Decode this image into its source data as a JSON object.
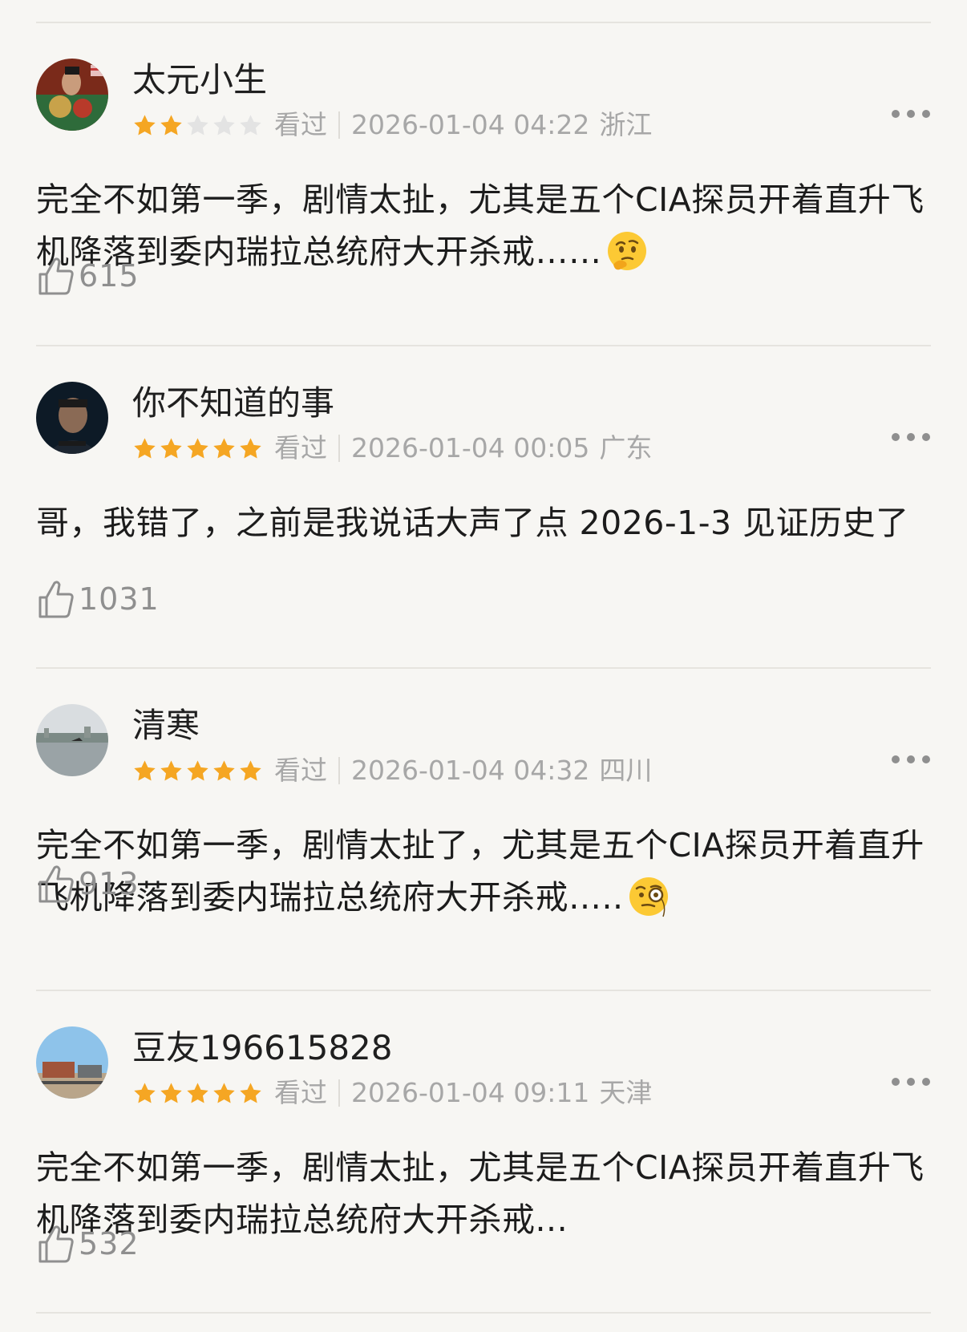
{
  "reviews": [
    {
      "username": "太元小生",
      "rating": 2,
      "max_rating": 5,
      "status": "看过",
      "datetime": "2026-01-04 04:22",
      "location": "浙江",
      "content": "完全不如第一季，剧情太扯，尤其是五个CIA探员开着直升飞机降落到委内瑞拉总统府大开杀戒……",
      "emoji": "thinking-face",
      "likes": "615"
    },
    {
      "username": "你不知道的事",
      "rating": 5,
      "max_rating": 5,
      "status": "看过",
      "datetime": "2026-01-04 00:05",
      "location": "广东",
      "content": "哥，我错了，之前是我说话大声了点 2026-1-3 见证历史了",
      "emoji": "",
      "likes": "1031"
    },
    {
      "username": "清寒",
      "rating": 5,
      "max_rating": 5,
      "status": "看过",
      "datetime": "2026-01-04 04:32",
      "location": "四川",
      "content": "完全不如第一季，剧情太扯了，尤其是五个CIA探员开着直升飞机降落到委内瑞拉总统府大开杀戒…..",
      "emoji": "face-with-monocle",
      "likes": "913"
    },
    {
      "username": "豆友196615828",
      "rating": 5,
      "max_rating": 5,
      "status": "看过",
      "datetime": "2026-01-04 09:11",
      "location": "天津",
      "content": "完全不如第一季，剧情太扯，尤其是五个CIA探员开着直升飞机降落到委内瑞拉总统府大开杀戒...",
      "emoji": "",
      "likes": "532"
    }
  ],
  "colors": {
    "background": "#f7f6f3",
    "star_filled": "#f5a623",
    "star_empty": "#e3e3e3",
    "meta_text": "#a7a7a7",
    "body_text": "#1c1c1c"
  },
  "icons": {
    "like": "thumbs-up-icon",
    "more": "more-icon",
    "star": "star-icon"
  }
}
